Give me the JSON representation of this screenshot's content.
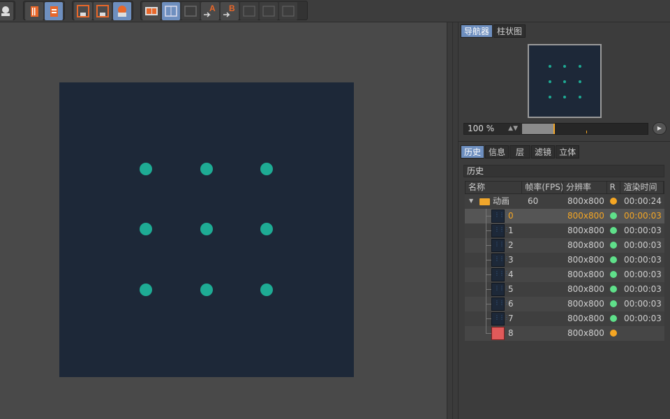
{
  "toolbar": {
    "groups": [
      [
        "render-icon"
      ],
      [
        "delete-icon",
        "copy-icon"
      ],
      [
        "region-icon",
        "view-icon",
        "mask-icon"
      ],
      [
        "ab-compare-icon",
        "ab-split-icon",
        "ab-overlay-icon",
        "set-a-icon",
        "set-b-icon",
        "channel-icon",
        "channel2-icon",
        "channel3-icon"
      ]
    ],
    "a_label": "A",
    "b_label": "B"
  },
  "navigator": {
    "tabs": [
      "导航器",
      "柱状图"
    ],
    "zoom_value": "100 %",
    "zoom_fraction": 0.25
  },
  "lower_tabs": [
    "历史",
    "信息",
    "层",
    "滤镜",
    "立体"
  ],
  "history": {
    "title": "历史",
    "columns": [
      "名称",
      "帧率(FPS)",
      "分辨率",
      "R",
      "渲染时间"
    ],
    "group": {
      "name": "动画",
      "fps": "60",
      "res": "800x800",
      "status": "#f5a623",
      "time": "00:00:24"
    },
    "rows": [
      {
        "name": "0",
        "res": "800x800",
        "status": "#5fe08a",
        "time": "00:00:03",
        "selected": true
      },
      {
        "name": "1",
        "res": "800x800",
        "status": "#5fe08a",
        "time": "00:00:03"
      },
      {
        "name": "2",
        "res": "800x800",
        "status": "#5fe08a",
        "time": "00:00:03"
      },
      {
        "name": "3",
        "res": "800x800",
        "status": "#5fe08a",
        "time": "00:00:03"
      },
      {
        "name": "4",
        "res": "800x800",
        "status": "#5fe08a",
        "time": "00:00:03"
      },
      {
        "name": "5",
        "res": "800x800",
        "status": "#5fe08a",
        "time": "00:00:03"
      },
      {
        "name": "6",
        "res": "800x800",
        "status": "#5fe08a",
        "time": "00:00:03"
      },
      {
        "name": "7",
        "res": "800x800",
        "status": "#5fe08a",
        "time": "00:00:03"
      },
      {
        "name": "8",
        "res": "800x800",
        "status": "#f5a623",
        "time": "",
        "red": true
      }
    ]
  },
  "colors": {
    "accent": "#f5a623",
    "ok": "#5fe08a",
    "dot": "#1eab94",
    "canvas": "#1d2838"
  }
}
